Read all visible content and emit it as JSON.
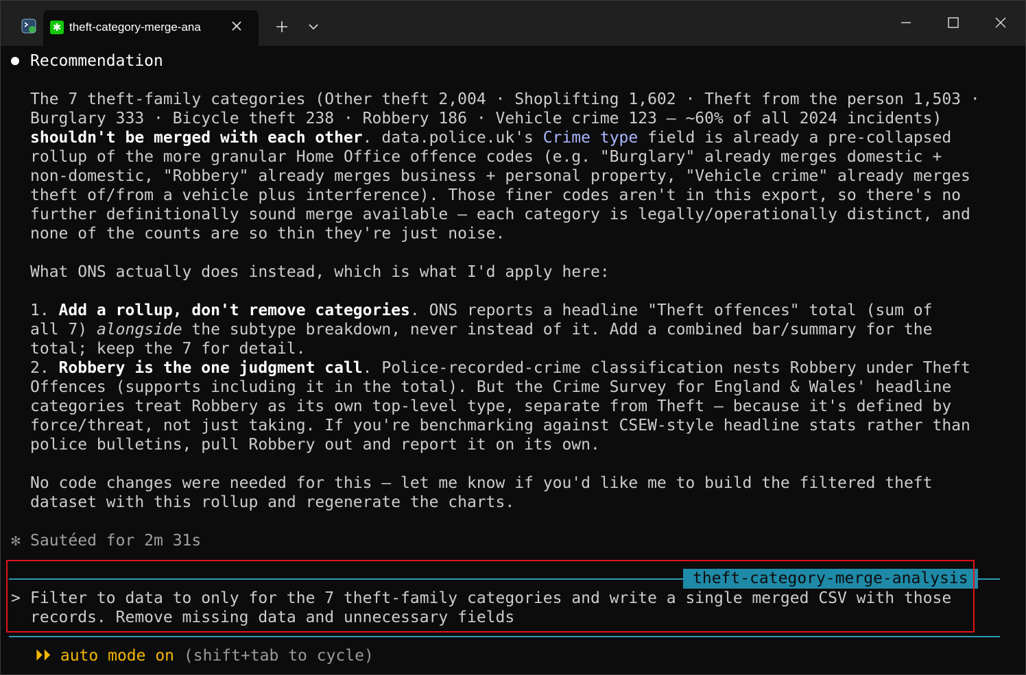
{
  "window": {
    "tab_title": "theft-category-merge-ana",
    "new_tab_symbol": "+",
    "icons": {
      "app": "terminal-app-icon",
      "tab": "asterisk-icon",
      "close": "close-icon",
      "new_tab": "plus-icon",
      "dropdown": "chevron-down-icon",
      "minimize": "minimize-icon",
      "maximize": "maximize-icon",
      "window_close": "close-icon"
    }
  },
  "response": {
    "heading": "Recommendation",
    "para1": {
      "l1": "The 7 theft-family categories (Other theft 2,004 · Shoplifting 1,602 · Theft from the person 1,503 ·",
      "l2": "Burglary 333 · Bicycle theft 238 · Robbery 186 · Vehicle crime 123 — ~60% of all 2024 incidents)",
      "l3_bold": "shouldn't be merged with each other",
      "l3_a": ". data.police.uk's ",
      "l3_code": "Crime type",
      "l3_b": " field is already a pre-collapsed",
      "l4": "rollup of the more granular Home Office offence codes (e.g. \"Burglary\" already merges domestic +",
      "l5": "non-domestic, \"Robbery\" already merges business + personal property, \"Vehicle crime\" already merges",
      "l6": "theft of/from a vehicle plus interference). Those finer codes aren't in this export, so there's no",
      "l7": "further definitionally sound merge available — each category is legally/operationally distinct, and",
      "l8": "none of the counts are so thin they're just noise."
    },
    "para2": "What ONS actually does instead, which is what I'd apply here:",
    "item1": {
      "num": "1. ",
      "bold": "Add a rollup, don't remove categories",
      "rest1": ". ONS reports a headline \"Theft offences\" total (sum of",
      "l2_a": "all 7) ",
      "l2_ital": "alongside",
      "l2_b": " the subtype breakdown, never instead of it. Add a combined bar/summary for the",
      "l3": "total; keep the 7 for detail."
    },
    "item2": {
      "num": "2. ",
      "bold": "Robbery is the one judgment call",
      "rest1": ". Police-recorded-crime classification nests Robbery under Theft",
      "l2": "Offences (supports including it in the total). But the Crime Survey for England & Wales' headline",
      "l3": "categories treat Robbery as its own top-level type, separate from Theft — because it's defined by",
      "l4": "force/threat, not just taking. If you're benchmarking against CSEW-style headline stats rather than",
      "l5": "police bulletins, pull Robbery out and report it on its own."
    },
    "para3": {
      "l1": "No code changes were needed for this — let me know if you'd like me to build the filtered theft",
      "l2": "dataset with this rollup and regenerate the charts."
    }
  },
  "status": {
    "glyph": "✻",
    "text": "Sautéed for 2m 31s"
  },
  "input": {
    "session_name": "theft-category-merge-analysis",
    "prompt_symbol": ">",
    "l1": "Filter to data to only for the 7 theft-family categories and write a single merged CSV with those",
    "l2": "records. Remove missing data and unnecessary fields"
  },
  "mode": {
    "arrows": "⏵⏵",
    "label": "auto mode on",
    "hint": "(shift+tab to cycle)"
  },
  "colors": {
    "accent": "#2a9bb5",
    "badge_bg": "#1f8aa8",
    "mode": "#f2b705",
    "highlight": "#e0141b",
    "code": "#a9b7ff"
  }
}
